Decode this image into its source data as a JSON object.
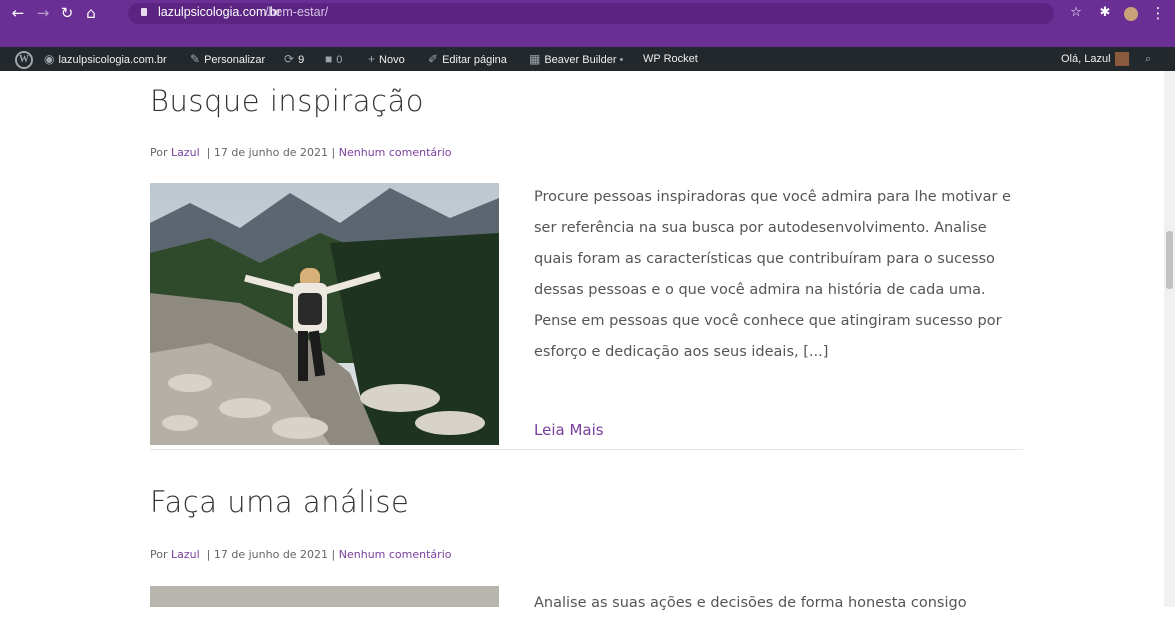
{
  "browser": {
    "url_host": "lazulpsicologia.com.br",
    "url_path": "/bem-estar/",
    "accent": "#6a2f94"
  },
  "adminbar": {
    "site": "lazulpsicologia.com.br",
    "customize": "Personalizar",
    "updates_count": "9",
    "comments_count": "0",
    "new": "Novo",
    "edit": "Editar página",
    "beaver": "Beaver Builder",
    "rocket": "WP Rocket",
    "greeting": "Olá, Lazul"
  },
  "posts": [
    {
      "title": "Busque inspiração",
      "by": "Por",
      "author": "Lazul",
      "date": "17 de junho de 2021",
      "comments": "Nenhum comentário",
      "excerpt": "Procure pessoas inspiradoras que você admira para lhe motivar e ser referência na sua busca por autodesenvolvimento. Analise quais foram as características que contribuíram para o sucesso dessas pessoas e o que você admira na história de cada uma. Pense em pessoas que você conhece que atingiram sucesso por esforço e dedicação aos seus ideais, [...]",
      "read_more": "Leia Mais"
    },
    {
      "title": "Faça uma análise",
      "by": "Por",
      "author": "Lazul",
      "date": "17 de junho de 2021",
      "comments": "Nenhum comentário",
      "excerpt": "Analise as suas ações e decisões de forma honesta consigo"
    }
  ],
  "colors": {
    "link": "#7a3f9d",
    "text": "#555555"
  }
}
